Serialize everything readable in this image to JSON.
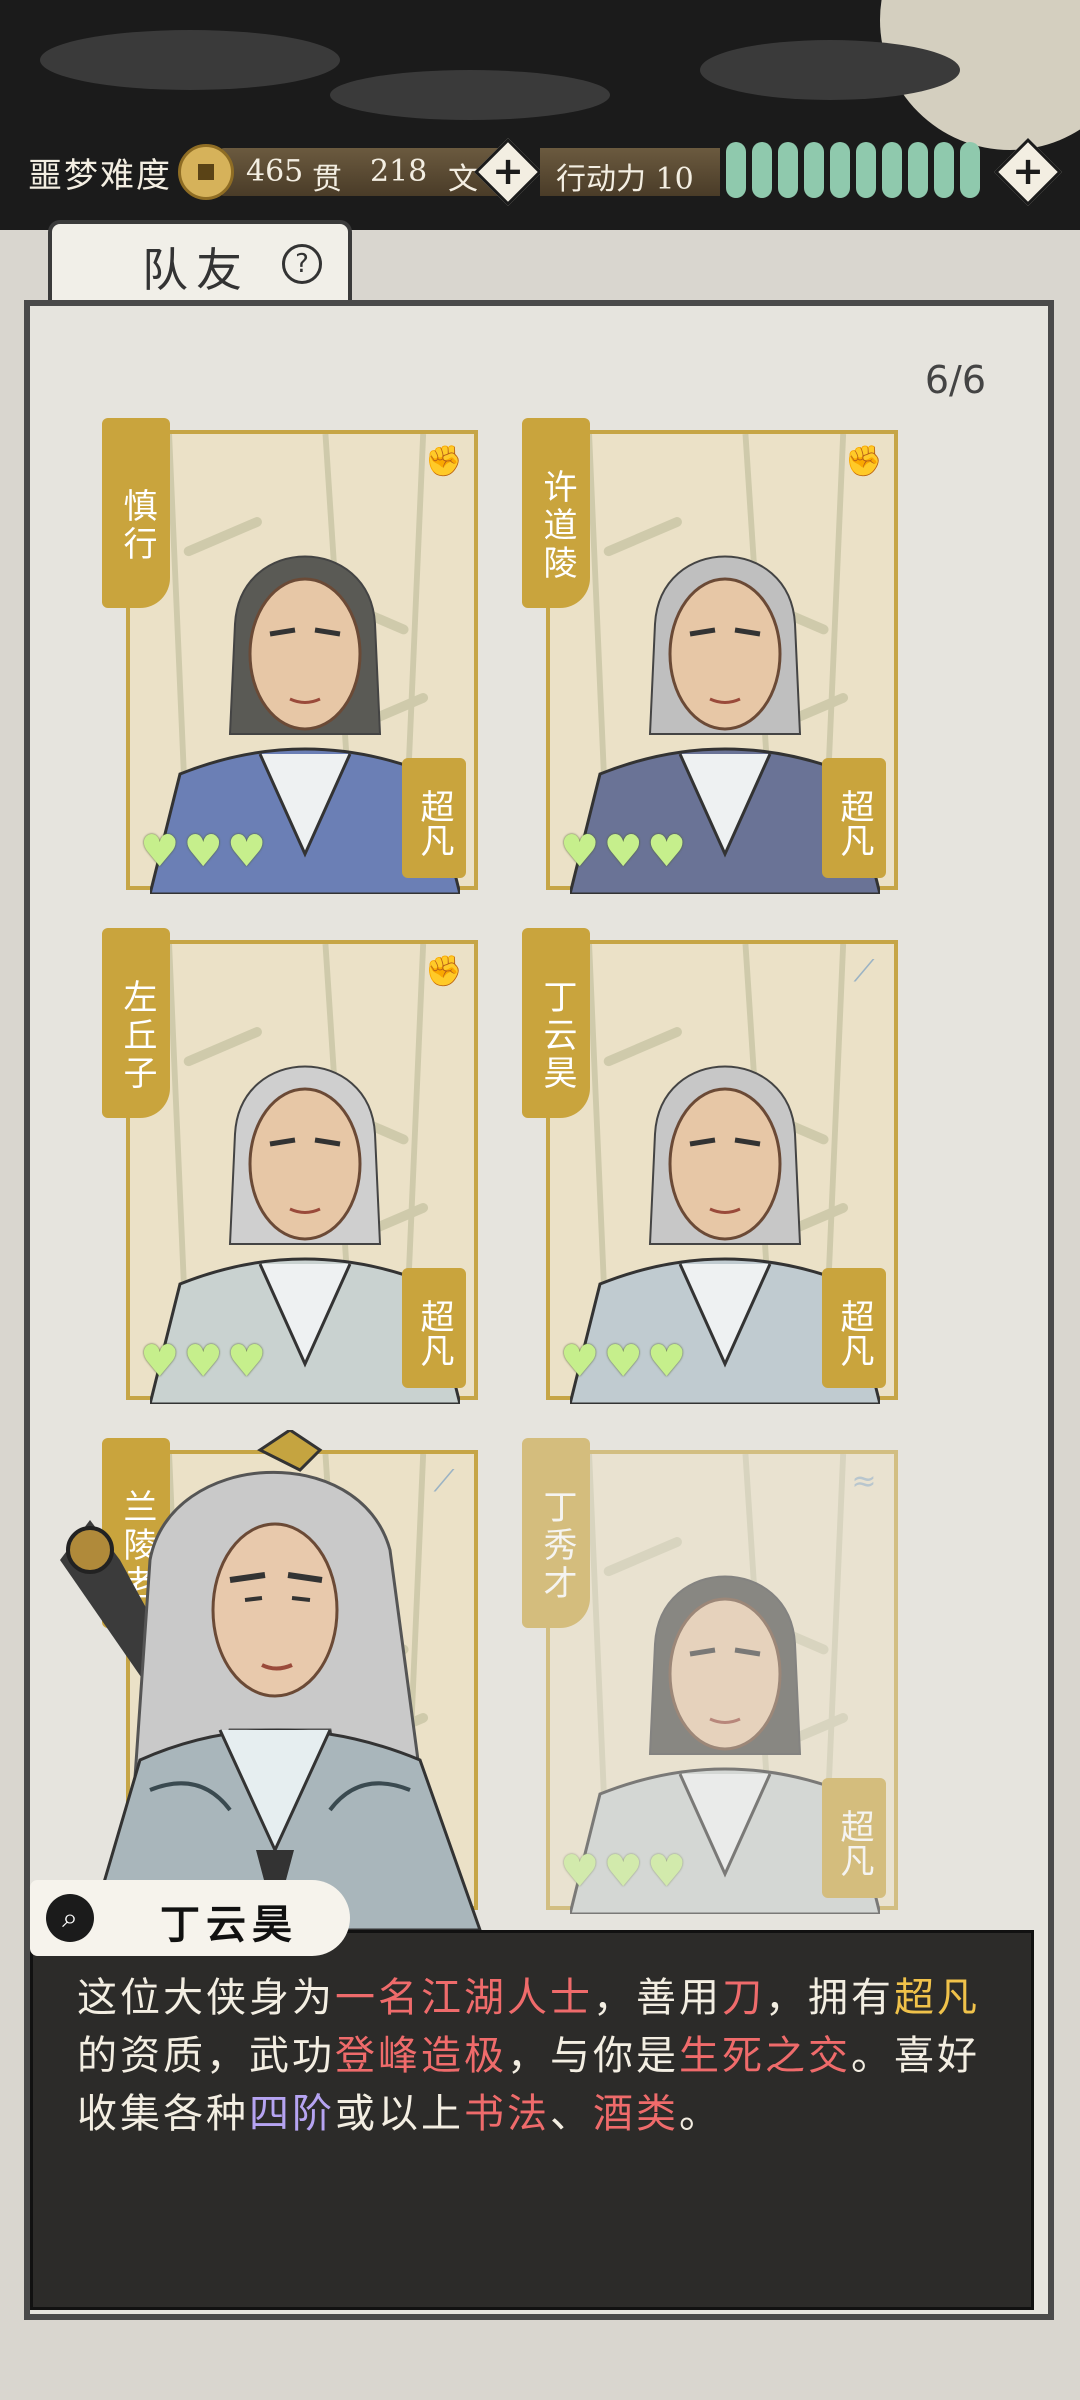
{
  "hud": {
    "difficulty": "噩梦难度",
    "guan_value": "465",
    "guan_unit": "贯",
    "wen_value": "218",
    "wen_unit": "文",
    "plus": "+",
    "action_label": "行动力",
    "action_value": "10",
    "action_pips": 10
  },
  "tab": {
    "label": "队友",
    "help": "?"
  },
  "panel": {
    "count": "6/6"
  },
  "cards": [
    {
      "name": "慎行",
      "rank": "超凡",
      "hearts": 3,
      "type_icon": "fist-icon"
    },
    {
      "name": "许道陵",
      "rank": "超凡",
      "hearts": 3,
      "type_icon": "fist-icon"
    },
    {
      "name": "左丘子",
      "rank": "超凡",
      "hearts": 3,
      "type_icon": "fist-icon"
    },
    {
      "name": "丁云昊",
      "rank": "超凡",
      "hearts": 3,
      "type_icon": "blade-icon"
    },
    {
      "name": "兰陵老",
      "rank": "",
      "hearts": 0,
      "type_icon": "blade-icon"
    },
    {
      "name": "丁秀才",
      "rank": "超凡",
      "hearts": 3,
      "type_icon": "brush-icon"
    }
  ],
  "dialog": {
    "speaker": "丁云昊",
    "segments": [
      {
        "text": "这位大侠身为",
        "style": "normal"
      },
      {
        "text": "一名江湖人士",
        "style": "red"
      },
      {
        "text": "，善用",
        "style": "normal"
      },
      {
        "text": "刀",
        "style": "red"
      },
      {
        "text": "，拥有",
        "style": "normal"
      },
      {
        "text": "超凡",
        "style": "gold"
      },
      {
        "text": "的资质，武功",
        "style": "normal"
      },
      {
        "text": "登峰造极",
        "style": "red"
      },
      {
        "text": "，与你是",
        "style": "normal"
      },
      {
        "text": "生死之交",
        "style": "red"
      },
      {
        "text": "。喜好收集各种",
        "style": "normal"
      },
      {
        "text": "四阶",
        "style": "purple"
      },
      {
        "text": "或以上",
        "style": "normal"
      },
      {
        "text": "书法",
        "style": "red"
      },
      {
        "text": "、",
        "style": "normal"
      },
      {
        "text": "酒类",
        "style": "red"
      },
      {
        "text": "。",
        "style": "normal"
      }
    ]
  }
}
